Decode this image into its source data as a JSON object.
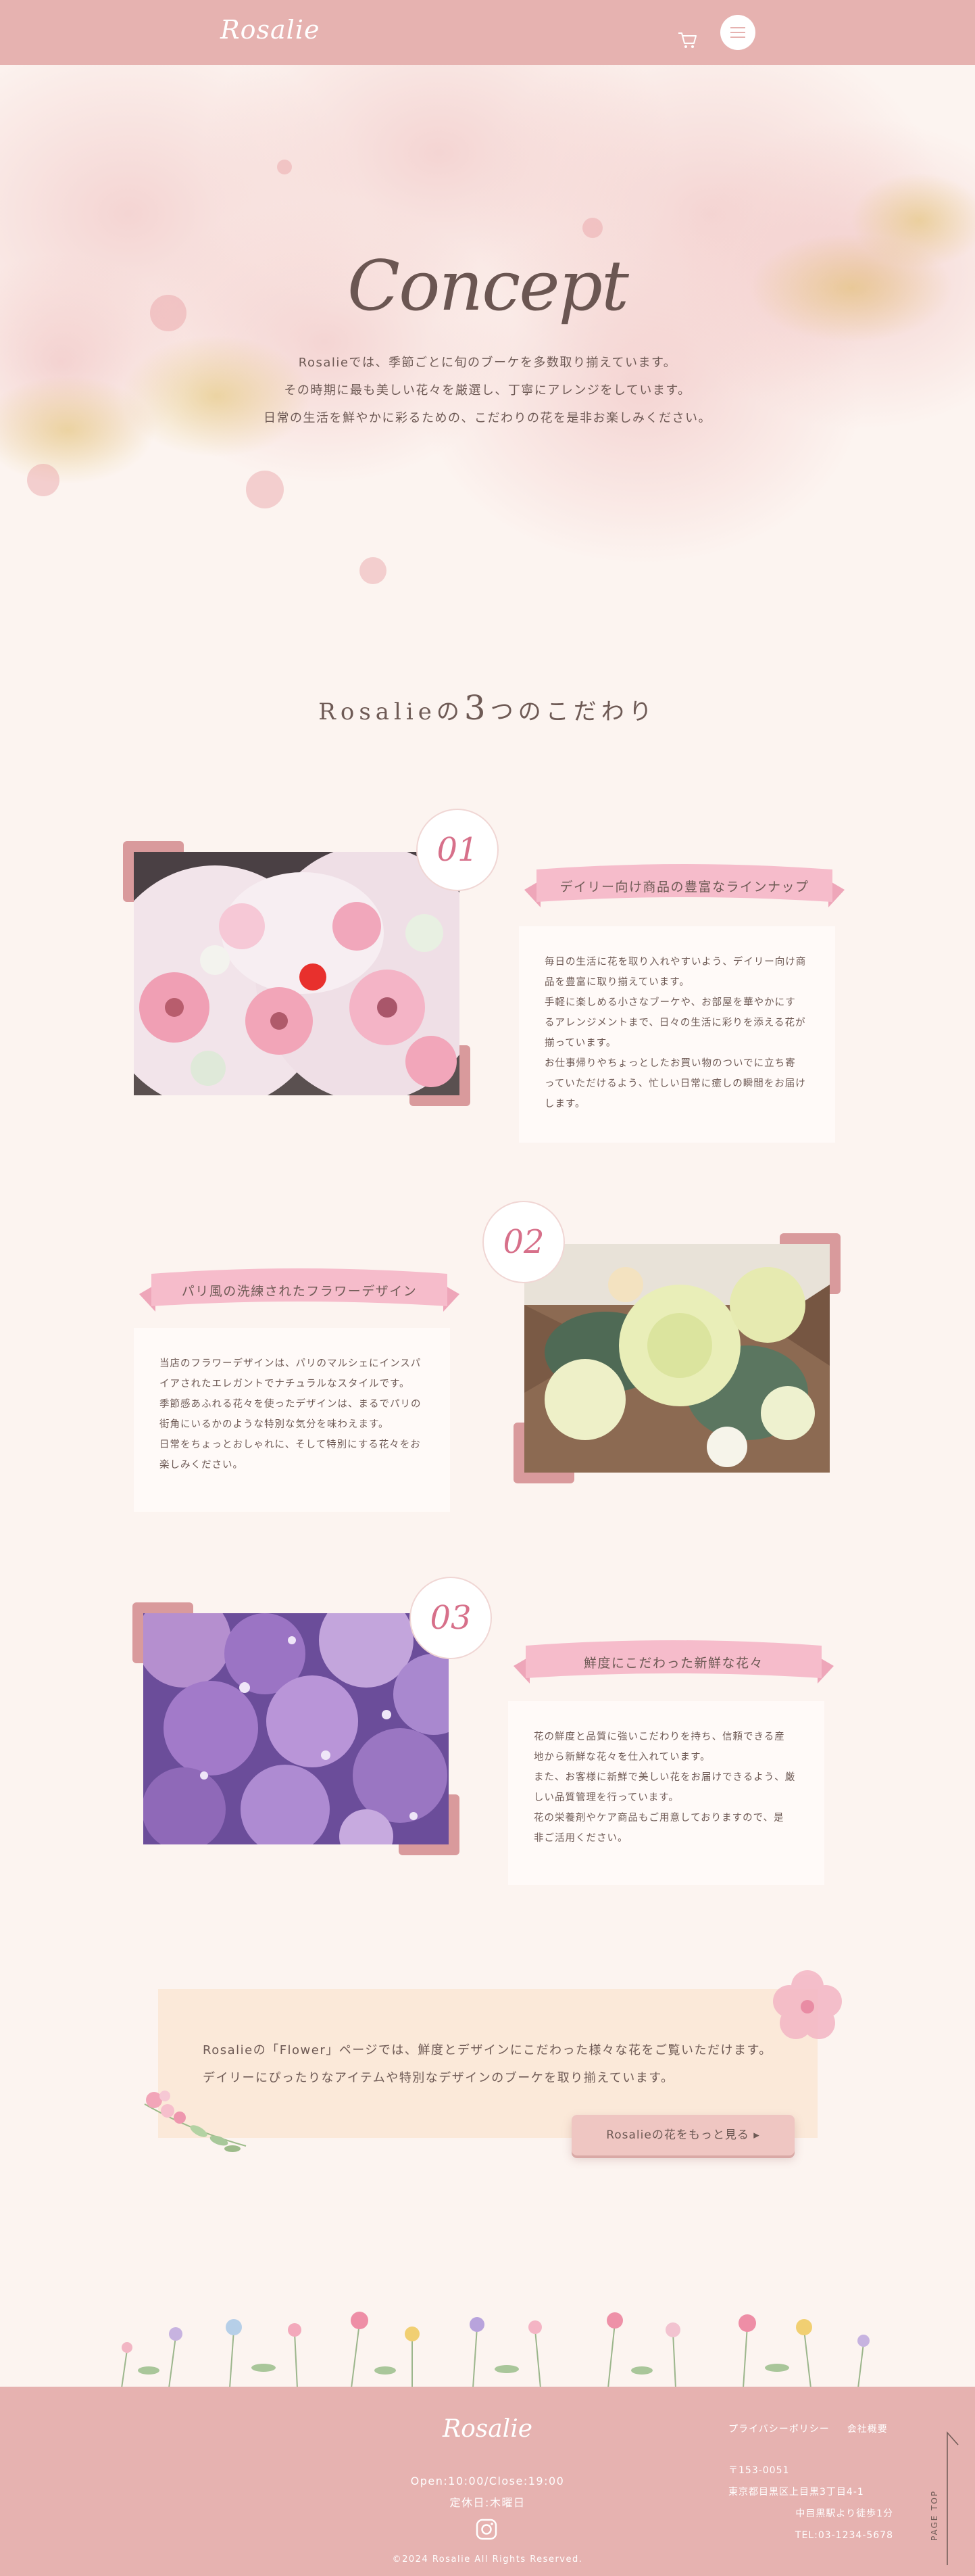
{
  "header": {
    "logo": "Rosalie",
    "icons": {
      "cart": "cart-icon",
      "menu": "hamburger-menu-icon"
    },
    "accent_color": "#e6b2b0"
  },
  "hero": {
    "title": "Concept",
    "lines": [
      "Rosalieでは、季節ごとに旬のブーケを多数取り揃えています。",
      "その時期に最も美しい花々を厳選し、丁寧にアレンジをしています。",
      "日常の生活を鮮やかに彩るための、こだわりの花を是非お楽しみください。"
    ]
  },
  "features_heading": {
    "prefix": "Rosalieの",
    "number": "3",
    "suffix": "つのこだわり"
  },
  "features": [
    {
      "number": "01",
      "title": "デイリー向け商品の豊富なラインナップ",
      "image": "pink-gerbera-bouquets-photo",
      "lines": [
        "毎日の生活に花を取り入れやすいよう、デイリー向け商",
        "品を豊富に取り揃えています。",
        "手軽に楽しめる小さなブーケや、お部屋を華やかにす",
        "るアレンジメントまで、日々の生活に彩りを添える花が",
        "揃っています。",
        "お仕事帰りやちょっとしたお買い物のついでに立ち寄",
        "っていただけるよう、忙しい日常に癒しの瞬間をお届け",
        "します。"
      ]
    },
    {
      "number": "02",
      "title": "パリ風の洗練されたフラワーデザイン",
      "image": "cream-rose-bouquet-photo",
      "lines": [
        "当店のフラワーデザインは、パリのマルシェにインスパ",
        "イアされたエレガントでナチュラルなスタイルです。",
        "季節感あふれる花々を使ったデザインは、まるでパリの",
        "街角にいるかのような特別な気分を味わえます。",
        "日常をちょっとおしゃれに、そして特別にする花々をお",
        "楽しみください。"
      ]
    },
    {
      "number": "03",
      "title": "鮮度にこだわった新鮮な花々",
      "image": "purple-hydrangea-photo",
      "lines": [
        "花の鮮度と品質に強いこだわりを持ち、信頼できる産",
        "地から新鮮な花々を仕入れています。",
        "また、お客様に新鮮で美しい花をお届けできるよう、厳",
        "しい品質管理を行っています。",
        "花の栄養剤やケア商品もご用意しておりますので、是",
        "非ご活用ください。"
      ]
    }
  ],
  "banner": {
    "lines": [
      "Rosalieの「Flower」ページでは、鮮度とデザインにこだわった様々な花をご覧いただけます。",
      "デイリーにぴったりなアイテムや特別なデザインのブーケを取り揃えています。"
    ],
    "button_label": "Rosalieの花をもっと見る ▸"
  },
  "footer": {
    "logo": "Rosalie",
    "hours": "Open:10:00/Close:19:00",
    "holiday": "定休日:木曜日",
    "instagram_icon": "instagram-icon",
    "copyright": "©2024 Rosalie All Rights Reserved.",
    "links": [
      "プライバシーポリシー",
      "会社概要"
    ],
    "address": [
      "〒153-0051",
      "東京都目黒区上目黒3丁目4-1",
      "中目黒駅より徒歩1分",
      "TEL:03-1234-5678"
    ],
    "page_top": "PAGE TOP"
  }
}
